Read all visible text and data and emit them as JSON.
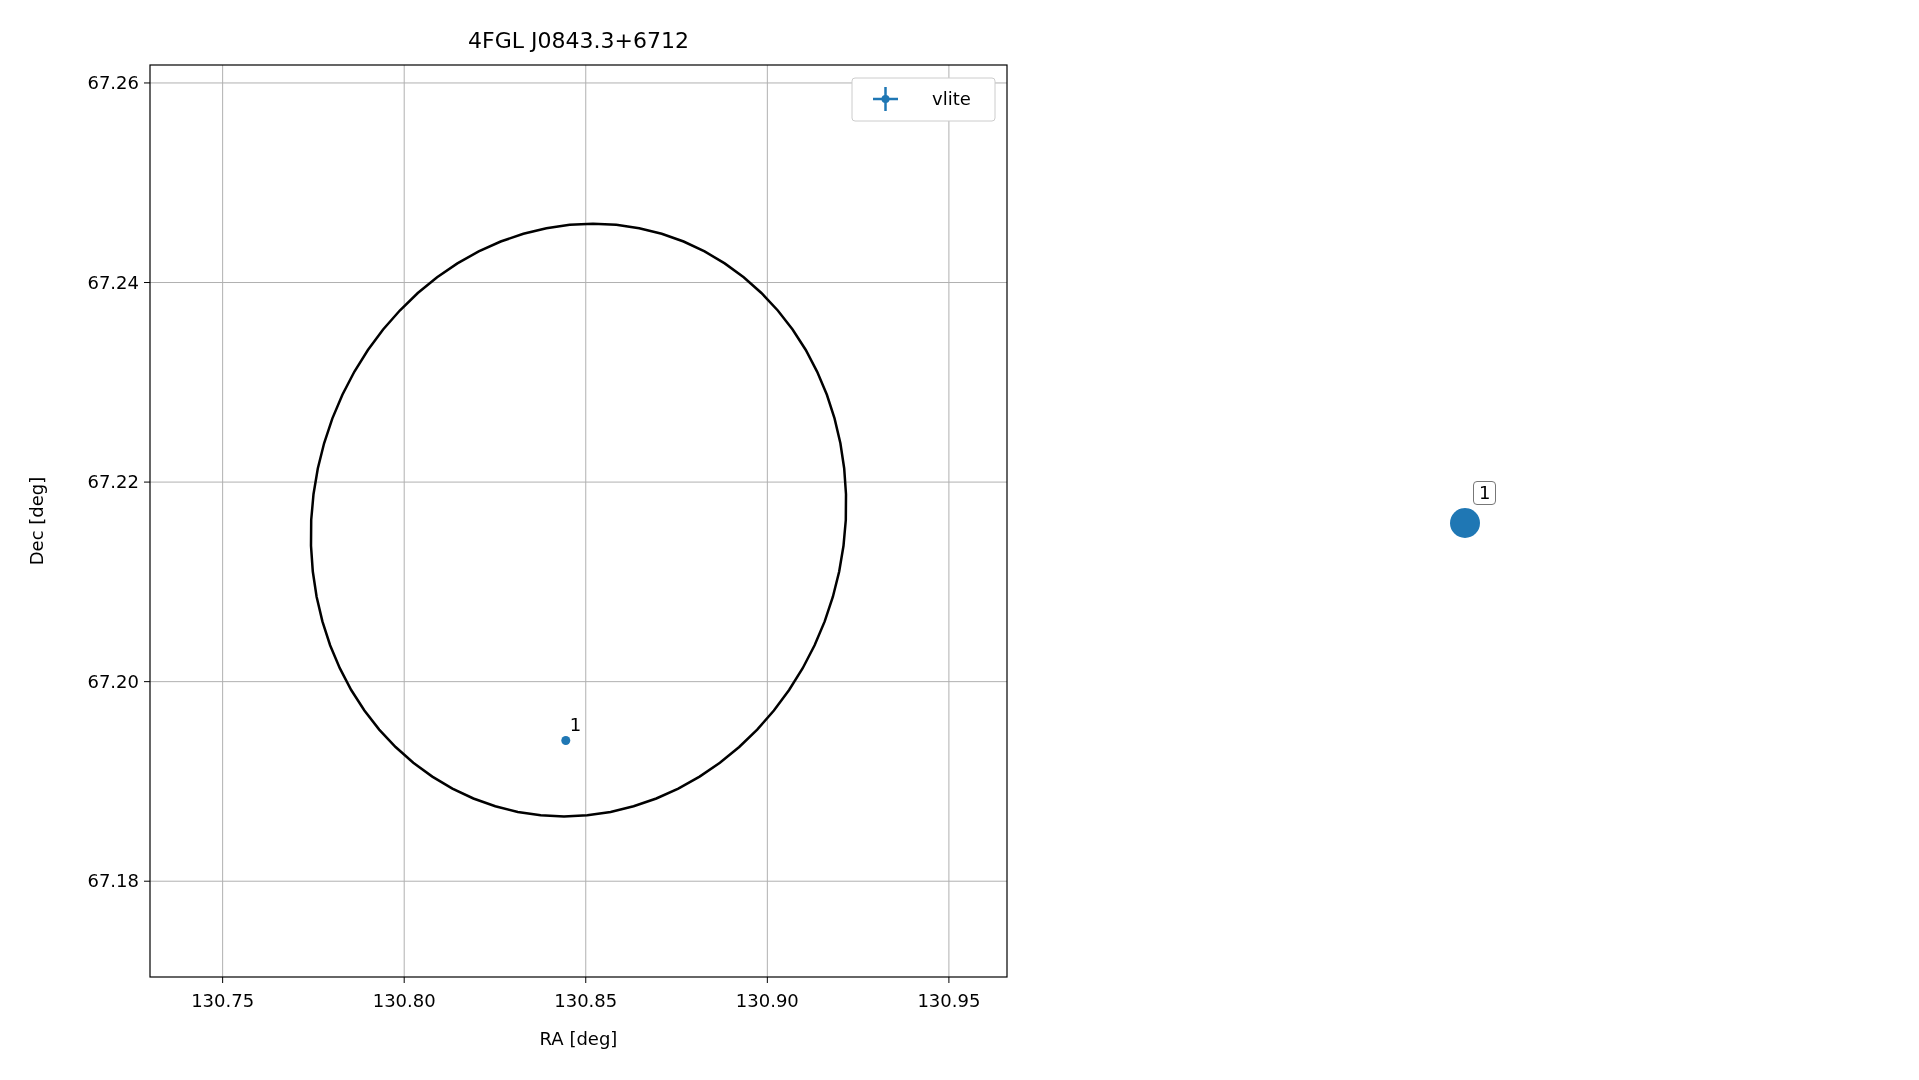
{
  "plot": {
    "chart_data": {
      "type": "scatter",
      "title": "4FGL J0843.3+6712",
      "xlabel": "RA [deg]",
      "ylabel": "Dec [deg]",
      "xlim": [
        130.73,
        130.966
      ],
      "ylim": [
        67.1704,
        67.2618
      ],
      "grid": true,
      "xticks": [
        {
          "value": 130.75,
          "label": "130.75"
        },
        {
          "value": 130.8,
          "label": "130.80"
        },
        {
          "value": 130.85,
          "label": "130.85"
        },
        {
          "value": 130.9,
          "label": "130.90"
        },
        {
          "value": 130.95,
          "label": "130.95"
        }
      ],
      "yticks": [
        {
          "value": 67.18,
          "label": "67.18"
        },
        {
          "value": 67.2,
          "label": "67.20"
        },
        {
          "value": 67.22,
          "label": "67.22"
        },
        {
          "value": 67.24,
          "label": "67.24"
        },
        {
          "value": 67.26,
          "label": "67.26"
        }
      ],
      "series": [
        {
          "name": "vlite",
          "color": "#1f77b4",
          "x": [
            130.8445
          ],
          "values": [
            67.1941
          ]
        }
      ],
      "annotations": [
        {
          "text": "1",
          "x": 130.8445,
          "y": 67.1941
        }
      ]
    }
  },
  "side_marker": {
    "label": "1",
    "color": "#1f77b4"
  }
}
